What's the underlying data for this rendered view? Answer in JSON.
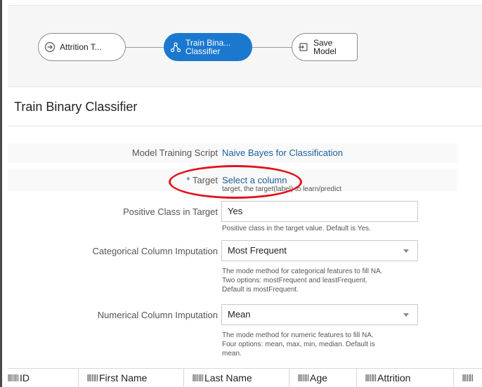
{
  "flow": {
    "nodes": [
      {
        "label": "Attrition T...",
        "icon": "dataset-arrow-icon"
      },
      {
        "label_line1": "Train Bina...",
        "label_line2": "Classifier",
        "icon": "model-train-icon"
      },
      {
        "label_line1": "Save",
        "label_line2": "Model",
        "icon": "save-model-icon"
      }
    ],
    "accent_color": "#1b78cf"
  },
  "panel": {
    "title": "Train Binary Classifier",
    "model_script": {
      "label": "Model Training Script",
      "value": "Naive Bayes for Classification"
    },
    "target": {
      "required_mark": "*",
      "label": "Target",
      "value": "Select a column",
      "helper": "target, the target(label) to learn/predict",
      "highlight_color": "#e0141b"
    },
    "positive_class": {
      "label": "Positive Class in Target",
      "value": "Yes",
      "helper": "Positive class in the target value. Default is Yes."
    },
    "categorical_imputation": {
      "label": "Categorical Column Imputation",
      "value": "Most Frequent",
      "helper_lines": [
        "The mode method for categorical features to fill NA.",
        "Two options: mostFrequent and leastFrequent.",
        "Default is mostFrequent."
      ]
    },
    "numerical_imputation": {
      "label": "Numerical Column Imputation",
      "value": "Mean",
      "helper_lines": [
        "The mode method for numeric features to fill NA.",
        "Four options: mean, max, min, median. Default is",
        "mean."
      ]
    }
  },
  "table": {
    "columns": [
      "ID",
      "First Name",
      "Last Name",
      "Age",
      "Attrition",
      ""
    ]
  }
}
